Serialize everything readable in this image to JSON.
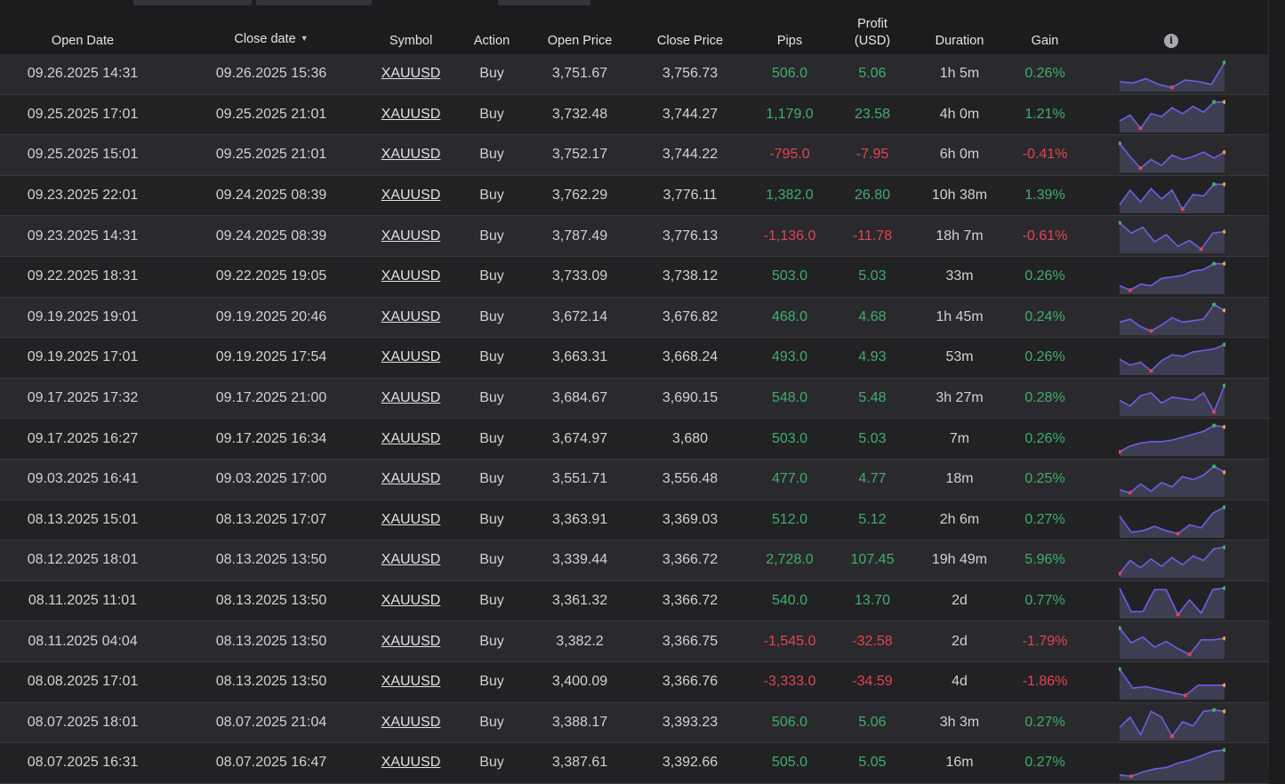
{
  "header": {
    "open_date": "Open Date",
    "close_date": "Close date",
    "sort_indicator": "▼",
    "symbol": "Symbol",
    "action": "Action",
    "open_price": "Open Price",
    "close_price": "Close Price",
    "pips": "Pips",
    "profit_line1": "Profit",
    "profit_line2": "(USD)",
    "duration": "Duration",
    "gain": "Gain",
    "info_icon": "info-icon"
  },
  "colors": {
    "positive": "#3fae6a",
    "negative": "#e2444f",
    "spark_line": "#6a5fe6",
    "spark_fill": "#3e3e52"
  },
  "rows": [
    {
      "open": "09.26.2025 14:31",
      "close": "09.26.2025 15:36",
      "symbol": "XAUUSD",
      "action": "Buy",
      "open_price": "3,751.67",
      "close_price": "3,756.73",
      "pips": "506.0",
      "profit": "5.06",
      "duration": "1h 5m",
      "gain": "0.26%",
      "sign": "pos",
      "spark": [
        0.25,
        0.2,
        0.35,
        0.15,
        0.05,
        0.3,
        0.25,
        0.15,
        0.9
      ],
      "hi": 8,
      "lo": 4,
      "last": "green"
    },
    {
      "open": "09.25.2025 17:01",
      "close": "09.25.2025 21:01",
      "symbol": "XAUUSD",
      "action": "Buy",
      "open_price": "3,732.48",
      "close_price": "3,744.27",
      "pips": "1,179.0",
      "profit": "23.58",
      "duration": "4h 0m",
      "gain": "1.21%",
      "sign": "pos",
      "spark": [
        0.3,
        0.5,
        0.05,
        0.55,
        0.45,
        0.75,
        0.55,
        0.8,
        0.6,
        0.95,
        0.95
      ],
      "hi": 9,
      "lo": 2,
      "last": "orange"
    },
    {
      "open": "09.25.2025 15:01",
      "close": "09.25.2025 21:01",
      "symbol": "XAUUSD",
      "action": "Buy",
      "open_price": "3,752.17",
      "close_price": "3,744.22",
      "pips": "-795.0",
      "profit": "-7.95",
      "duration": "6h 0m",
      "gain": "-0.41%",
      "sign": "neg",
      "spark": [
        0.9,
        0.45,
        0.05,
        0.35,
        0.15,
        0.5,
        0.35,
        0.45,
        0.6,
        0.4,
        0.6
      ],
      "hi": 0,
      "lo": 2,
      "last": "orange"
    },
    {
      "open": "09.23.2025 22:01",
      "close": "09.24.2025 08:39",
      "symbol": "XAUUSD",
      "action": "Buy",
      "open_price": "3,762.29",
      "close_price": "3,776.11",
      "pips": "1,382.0",
      "profit": "26.80",
      "duration": "10h 38m",
      "gain": "1.39%",
      "sign": "pos",
      "spark": [
        0.2,
        0.7,
        0.3,
        0.75,
        0.4,
        0.7,
        0.05,
        0.55,
        0.5,
        0.9,
        0.9
      ],
      "hi": 9,
      "lo": 6,
      "last": "orange"
    },
    {
      "open": "09.23.2025 14:31",
      "close": "09.24.2025 08:39",
      "symbol": "XAUUSD",
      "action": "Buy",
      "open_price": "3,787.49",
      "close_price": "3,776.13",
      "pips": "-1,136.0",
      "profit": "-11.78",
      "duration": "18h 7m",
      "gain": "-0.61%",
      "sign": "neg",
      "spark": [
        0.95,
        0.6,
        0.8,
        0.3,
        0.55,
        0.15,
        0.35,
        0.05,
        0.6,
        0.65
      ],
      "hi": 0,
      "lo": 7,
      "last": "orange"
    },
    {
      "open": "09.22.2025 18:31",
      "close": "09.22.2025 19:05",
      "symbol": "XAUUSD",
      "action": "Buy",
      "open_price": "3,733.09",
      "close_price": "3,738.12",
      "pips": "503.0",
      "profit": "5.03",
      "duration": "33m",
      "gain": "0.26%",
      "sign": "pos",
      "spark": [
        0.2,
        0.05,
        0.25,
        0.2,
        0.45,
        0.5,
        0.55,
        0.7,
        0.75,
        0.95,
        0.95
      ],
      "hi": 9,
      "lo": 1,
      "last": "orange"
    },
    {
      "open": "09.19.2025 19:01",
      "close": "09.19.2025 20:46",
      "symbol": "XAUUSD",
      "action": "Buy",
      "open_price": "3,672.14",
      "close_price": "3,676.82",
      "pips": "468.0",
      "profit": "4.68",
      "duration": "1h 45m",
      "gain": "0.24%",
      "sign": "pos",
      "spark": [
        0.35,
        0.45,
        0.2,
        0.05,
        0.25,
        0.5,
        0.35,
        0.4,
        0.45,
        0.95,
        0.75
      ],
      "hi": 9,
      "lo": 3,
      "last": "orange"
    },
    {
      "open": "09.19.2025 17:01",
      "close": "09.19.2025 17:54",
      "symbol": "XAUUSD",
      "action": "Buy",
      "open_price": "3,663.31",
      "close_price": "3,668.24",
      "pips": "493.0",
      "profit": "4.93",
      "duration": "53m",
      "gain": "0.26%",
      "sign": "pos",
      "spark": [
        0.45,
        0.25,
        0.35,
        0.05,
        0.4,
        0.6,
        0.55,
        0.7,
        0.75,
        0.8,
        0.95
      ],
      "hi": 10,
      "lo": 3,
      "last": "green"
    },
    {
      "open": "09.17.2025 17:32",
      "close": "09.17.2025 21:00",
      "symbol": "XAUUSD",
      "action": "Buy",
      "open_price": "3,684.67",
      "close_price": "3,690.15",
      "pips": "548.0",
      "profit": "5.48",
      "duration": "3h 27m",
      "gain": "0.28%",
      "sign": "pos",
      "spark": [
        0.45,
        0.25,
        0.6,
        0.7,
        0.35,
        0.55,
        0.5,
        0.45,
        0.7,
        0.05,
        0.95
      ],
      "hi": 10,
      "lo": 9,
      "last": "green"
    },
    {
      "open": "09.17.2025 16:27",
      "close": "09.17.2025 16:34",
      "symbol": "XAUUSD",
      "action": "Buy",
      "open_price": "3,674.97",
      "close_price": "3,680",
      "pips": "503.0",
      "profit": "5.03",
      "duration": "7m",
      "gain": "0.26%",
      "sign": "pos",
      "spark": [
        0.05,
        0.25,
        0.35,
        0.4,
        0.4,
        0.45,
        0.55,
        0.65,
        0.75,
        0.95,
        0.9
      ],
      "hi": 9,
      "lo": 0,
      "last": "orange"
    },
    {
      "open": "09.03.2025 16:41",
      "close": "09.03.2025 17:00",
      "symbol": "XAUUSD",
      "action": "Buy",
      "open_price": "3,551.71",
      "close_price": "3,556.48",
      "pips": "477.0",
      "profit": "4.77",
      "duration": "18m",
      "gain": "0.25%",
      "sign": "pos",
      "spark": [
        0.15,
        0.05,
        0.35,
        0.1,
        0.4,
        0.25,
        0.6,
        0.5,
        0.65,
        0.95,
        0.75
      ],
      "hi": 9,
      "lo": 1,
      "last": "orange"
    },
    {
      "open": "08.13.2025 15:01",
      "close": "08.13.2025 17:07",
      "symbol": "XAUUSD",
      "action": "Buy",
      "open_price": "3,363.91",
      "close_price": "3,369.03",
      "pips": "512.0",
      "profit": "5.12",
      "duration": "2h 6m",
      "gain": "0.27%",
      "sign": "pos",
      "spark": [
        0.65,
        0.1,
        0.15,
        0.3,
        0.15,
        0.05,
        0.35,
        0.25,
        0.75,
        0.95
      ],
      "hi": 9,
      "lo": 5,
      "last": "green"
    },
    {
      "open": "08.12.2025 18:01",
      "close": "08.13.2025 13:50",
      "symbol": "XAUUSD",
      "action": "Buy",
      "open_price": "3,339.44",
      "close_price": "3,366.72",
      "pips": "2,728.0",
      "profit": "107.45",
      "duration": "19h 49m",
      "gain": "5.96%",
      "sign": "pos",
      "spark": [
        0.05,
        0.5,
        0.25,
        0.55,
        0.3,
        0.6,
        0.35,
        0.65,
        0.5,
        0.9,
        0.95
      ],
      "hi": 10,
      "lo": 0,
      "last": "green"
    },
    {
      "open": "08.11.2025 11:01",
      "close": "08.13.2025 13:50",
      "symbol": "XAUUSD",
      "action": "Buy",
      "open_price": "3,361.32",
      "close_price": "3,366.72",
      "pips": "540.0",
      "profit": "13.70",
      "duration": "2d",
      "gain": "0.77%",
      "sign": "pos",
      "spark": [
        0.95,
        0.15,
        0.15,
        0.9,
        0.9,
        0.05,
        0.55,
        0.1,
        0.9,
        0.95
      ],
      "hi": 9,
      "lo": 5,
      "last": "green"
    },
    {
      "open": "08.11.2025 04:04",
      "close": "08.13.2025 13:50",
      "symbol": "XAUUSD",
      "action": "Buy",
      "open_price": "3,382.2",
      "close_price": "3,366.75",
      "pips": "-1,545.0",
      "profit": "-32.58",
      "duration": "2d",
      "gain": "-1.79%",
      "sign": "neg",
      "spark": [
        0.95,
        0.45,
        0.65,
        0.3,
        0.5,
        0.25,
        0.05,
        0.55,
        0.55,
        0.6
      ],
      "hi": 0,
      "lo": 6,
      "last": "orange"
    },
    {
      "open": "08.08.2025 17:01",
      "close": "08.13.2025 13:50",
      "symbol": "XAUUSD",
      "action": "Buy",
      "open_price": "3,400.09",
      "close_price": "3,366.76",
      "pips": "-3,333.0",
      "profit": "-34.59",
      "duration": "4d",
      "gain": "-1.86%",
      "sign": "neg",
      "spark": [
        0.95,
        0.3,
        0.35,
        0.25,
        0.15,
        0.05,
        0.4,
        0.4,
        0.4
      ],
      "hi": 0,
      "lo": 5,
      "last": "orange"
    },
    {
      "open": "08.07.2025 18:01",
      "close": "08.07.2025 21:04",
      "symbol": "XAUUSD",
      "action": "Buy",
      "open_price": "3,388.17",
      "close_price": "3,393.23",
      "pips": "506.0",
      "profit": "5.06",
      "duration": "3h 3m",
      "gain": "0.27%",
      "sign": "pos",
      "spark": [
        0.35,
        0.7,
        0.1,
        0.9,
        0.7,
        0.05,
        0.55,
        0.4,
        0.9,
        0.95,
        0.9
      ],
      "hi": 9,
      "lo": 5,
      "last": "orange"
    },
    {
      "open": "08.07.2025 16:31",
      "close": "08.07.2025 16:47",
      "symbol": "XAUUSD",
      "action": "Buy",
      "open_price": "3,387.61",
      "close_price": "3,392.66",
      "pips": "505.0",
      "profit": "5.05",
      "duration": "16m",
      "gain": "0.27%",
      "sign": "pos",
      "spark": [
        0.1,
        0.05,
        0.2,
        0.3,
        0.35,
        0.5,
        0.6,
        0.75,
        0.9,
        0.95
      ],
      "hi": 9,
      "lo": 1,
      "last": "green"
    }
  ]
}
